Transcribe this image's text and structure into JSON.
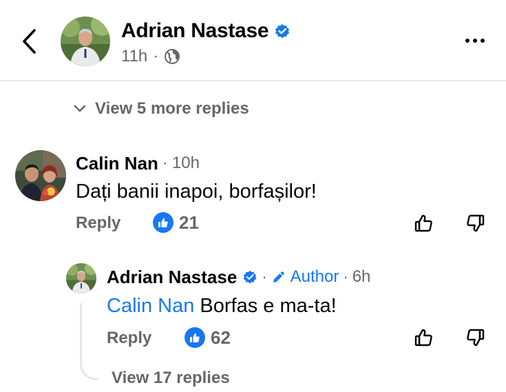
{
  "post_header": {
    "author_name": "Adrian Nastase",
    "time": "11h",
    "separator": "·"
  },
  "view_more_replies": "View 5 more replies",
  "comments": [
    {
      "author": "Calin Nan",
      "time": "10h",
      "text": "Dați banii inapoi, borfașilor!",
      "reply_label": "Reply",
      "likes": "21"
    }
  ],
  "reply": {
    "author": "Adrian Nastase",
    "badge": "Author",
    "time": "6h",
    "mention": "Calin Nan",
    "text": "Borfas e ma-ta!",
    "reply_label": "Reply",
    "likes": "62"
  },
  "view_replies": "View 17 replies",
  "colors": {
    "accent": "#1877f2",
    "muted": "#65676b",
    "text": "#050505"
  },
  "icons": [
    "back-icon",
    "verified-icon",
    "globe-icon",
    "more-icon",
    "chevron-down-icon",
    "like-icon",
    "thumbs-up-icon",
    "thumbs-down-icon",
    "pencil-icon"
  ]
}
